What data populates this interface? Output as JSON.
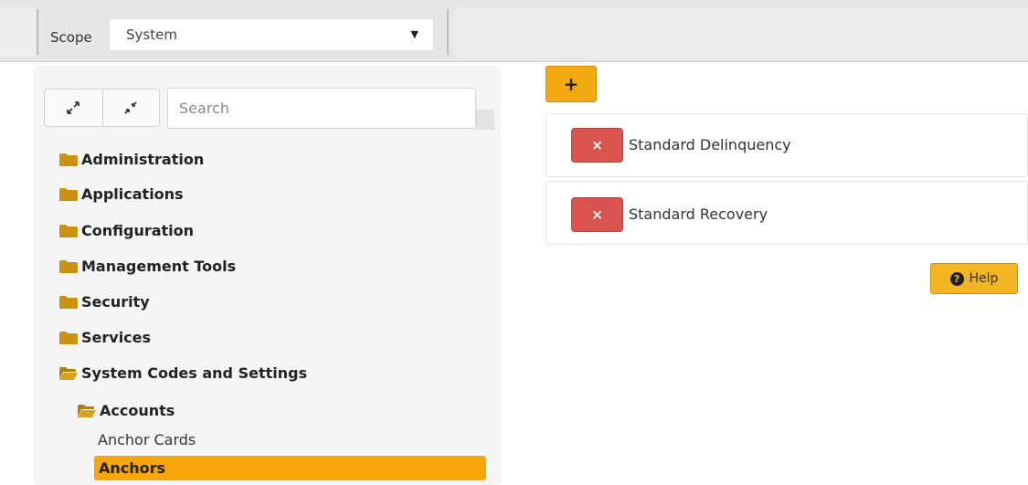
{
  "scope": {
    "label": "Scope",
    "selected_value": "System",
    "caret": "▼"
  },
  "toolbar": {
    "expand_icon": "expand-icon",
    "collapse_icon": "collapse-icon",
    "search_placeholder": "Search"
  },
  "tree": {
    "folders": [
      {
        "label": "Administration",
        "icon": "folder-closed-icon"
      },
      {
        "label": "Applications",
        "icon": "folder-closed-icon"
      },
      {
        "label": "Configuration",
        "icon": "folder-closed-icon"
      },
      {
        "label": "Management Tools",
        "icon": "folder-closed-icon"
      },
      {
        "label": "Security",
        "icon": "folder-closed-icon"
      },
      {
        "label": "Services",
        "icon": "folder-closed-icon"
      },
      {
        "label": "System Codes and Settings",
        "icon": "folder-open-icon"
      }
    ],
    "subfolder": {
      "label": "Accounts",
      "icon": "folder-open-icon"
    },
    "leaves": [
      {
        "label": "Anchor Cards",
        "selected": false
      },
      {
        "label": "Anchors",
        "selected": true
      }
    ]
  },
  "main": {
    "add_label": "+",
    "items": [
      {
        "label": "Standard Delinquency",
        "delete_label": "×"
      },
      {
        "label": "Standard Recovery",
        "delete_label": "×"
      }
    ],
    "help_label": "Help",
    "help_icon_glyph": "?"
  },
  "colors": {
    "accent": "#f3a912",
    "selected": "#f6a609",
    "danger": "#d9534f",
    "folder": "#c9920f"
  }
}
